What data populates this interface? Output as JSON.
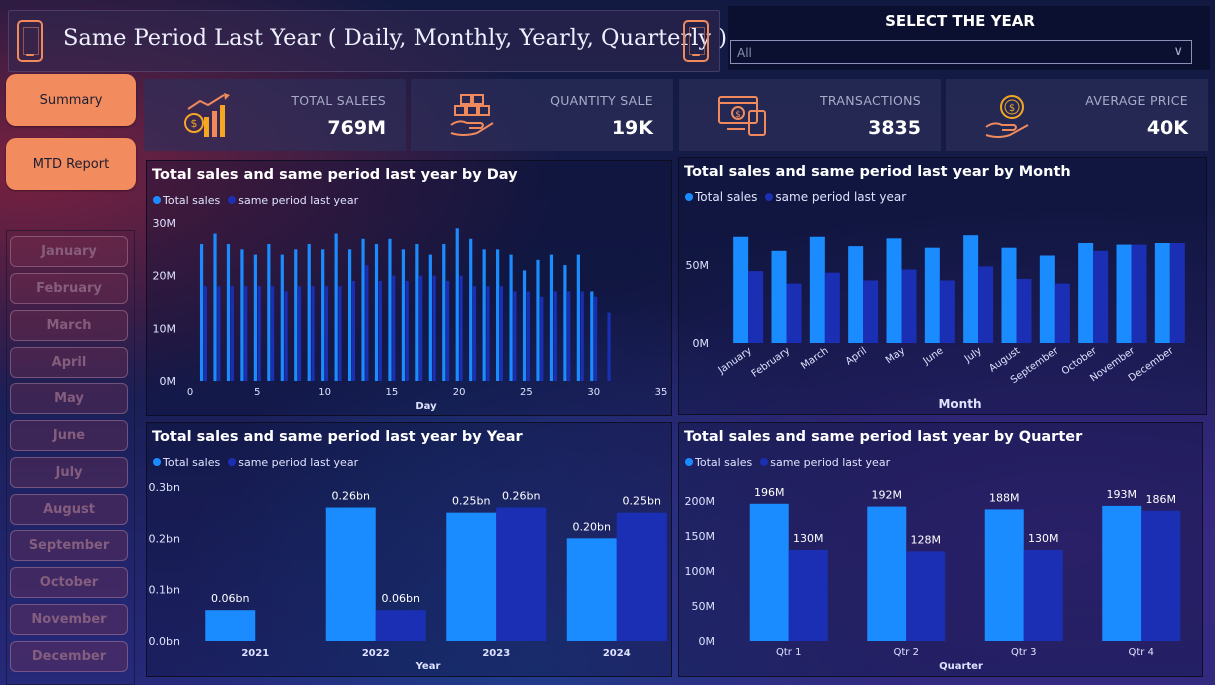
{
  "header": {
    "title": "Same Period Last Year ( Daily, Monthly, Yearly, Quarterly )"
  },
  "year_filter": {
    "label": "SELECT THE YEAR",
    "value": "All"
  },
  "nav": {
    "summary": "Summary",
    "mtd": "MTD Report"
  },
  "months": [
    "January",
    "February",
    "March",
    "April",
    "May",
    "June",
    "July",
    "August",
    "September",
    "October",
    "November",
    "December"
  ],
  "kpis": [
    {
      "label": "TOTAL SALEES",
      "value": "769M",
      "icon": "sales-chart-icon"
    },
    {
      "label": "QUANTITY SALE",
      "value": "19K",
      "icon": "boxes-hand-icon"
    },
    {
      "label": "TRANSACTIONS",
      "value": "3835",
      "icon": "payment-transaction-icon"
    },
    {
      "label": "AVERAGE PRICE",
      "value": "40K",
      "icon": "coin-hand-icon"
    }
  ],
  "colors": {
    "total_sales": "#1b8cff",
    "same_period_last_year": "#1b2fb5",
    "accent": "#f28c5e"
  },
  "chart_data": [
    {
      "id": "day",
      "type": "bar",
      "title": "Total sales and same period last year by Day",
      "xlabel": "Day",
      "ylabel": "",
      "xlim": [
        0,
        35
      ],
      "ylim": [
        0,
        30
      ],
      "x_ticks": [
        0,
        5,
        10,
        15,
        20,
        25,
        30,
        35
      ],
      "y_ticks": [
        "0M",
        "10M",
        "20M",
        "30M"
      ],
      "x": [
        1,
        2,
        3,
        4,
        5,
        6,
        7,
        8,
        9,
        10,
        11,
        12,
        13,
        14,
        15,
        16,
        17,
        18,
        19,
        20,
        21,
        22,
        23,
        24,
        25,
        26,
        27,
        28,
        29,
        30,
        31
      ],
      "series": [
        {
          "name": "Total sales",
          "values": [
            26,
            28,
            26,
            25,
            24,
            26,
            24,
            25,
            26,
            25,
            28,
            25,
            27,
            26,
            27,
            25,
            26,
            24,
            26,
            29,
            27,
            25,
            25,
            24,
            21,
            23,
            24,
            22,
            24,
            17,
            null
          ]
        },
        {
          "name": "same period last year",
          "values": [
            18,
            18,
            18,
            18,
            18,
            18,
            17,
            18,
            18,
            18,
            18,
            19,
            22,
            19,
            20,
            19,
            20,
            20,
            19,
            20,
            18,
            18,
            18,
            17,
            17,
            16,
            17,
            17,
            17,
            16,
            13
          ]
        }
      ]
    },
    {
      "id": "month",
      "type": "bar",
      "title": "Total sales and same period last year by Month",
      "xlabel": "Month",
      "ylabel": "",
      "ylim": [
        0,
        80
      ],
      "y_ticks": [
        "0M",
        "50M"
      ],
      "categories": [
        "January",
        "February",
        "March",
        "April",
        "May",
        "June",
        "July",
        "August",
        "September",
        "October",
        "November",
        "December"
      ],
      "series": [
        {
          "name": "Total sales",
          "values": [
            68,
            59,
            68,
            62,
            67,
            61,
            69,
            61,
            56,
            64,
            63,
            64
          ]
        },
        {
          "name": "same period last year",
          "values": [
            46,
            38,
            45,
            40,
            47,
            40,
            49,
            41,
            38,
            59,
            63,
            64
          ]
        }
      ]
    },
    {
      "id": "year",
      "type": "bar",
      "title": "Total sales and same period last year by Year",
      "xlabel": "Year",
      "ylabel": "",
      "ylim": [
        0,
        0.3
      ],
      "y_ticks": [
        "0.0bn",
        "0.1bn",
        "0.2bn",
        "0.3bn"
      ],
      "categories": [
        "2021",
        "2022",
        "2023",
        "2024"
      ],
      "series": [
        {
          "name": "Total sales",
          "values": [
            0.06,
            0.26,
            0.25,
            0.2
          ],
          "labels": [
            "0.06bn",
            "0.26bn",
            "0.25bn",
            "0.20bn"
          ]
        },
        {
          "name": "same period last year",
          "values": [
            null,
            0.06,
            0.26,
            0.25
          ],
          "labels": [
            "",
            "0.06bn",
            "0.26bn",
            "0.25bn"
          ]
        }
      ]
    },
    {
      "id": "quarter",
      "type": "bar",
      "title": "Total sales and same period last year by Quarter",
      "xlabel": "Quarter",
      "ylabel": "",
      "ylim": [
        0,
        200
      ],
      "y_ticks": [
        "0M",
        "50M",
        "100M",
        "150M",
        "200M"
      ],
      "categories": [
        "Qtr 1",
        "Qtr 2",
        "Qtr 3",
        "Qtr 4"
      ],
      "series": [
        {
          "name": "Total sales",
          "values": [
            196,
            192,
            188,
            193
          ],
          "labels": [
            "196M",
            "192M",
            "188M",
            "193M"
          ]
        },
        {
          "name": "same period last year",
          "values": [
            130,
            128,
            130,
            186
          ],
          "labels": [
            "130M",
            "128M",
            "130M",
            "186M"
          ]
        }
      ]
    }
  ]
}
